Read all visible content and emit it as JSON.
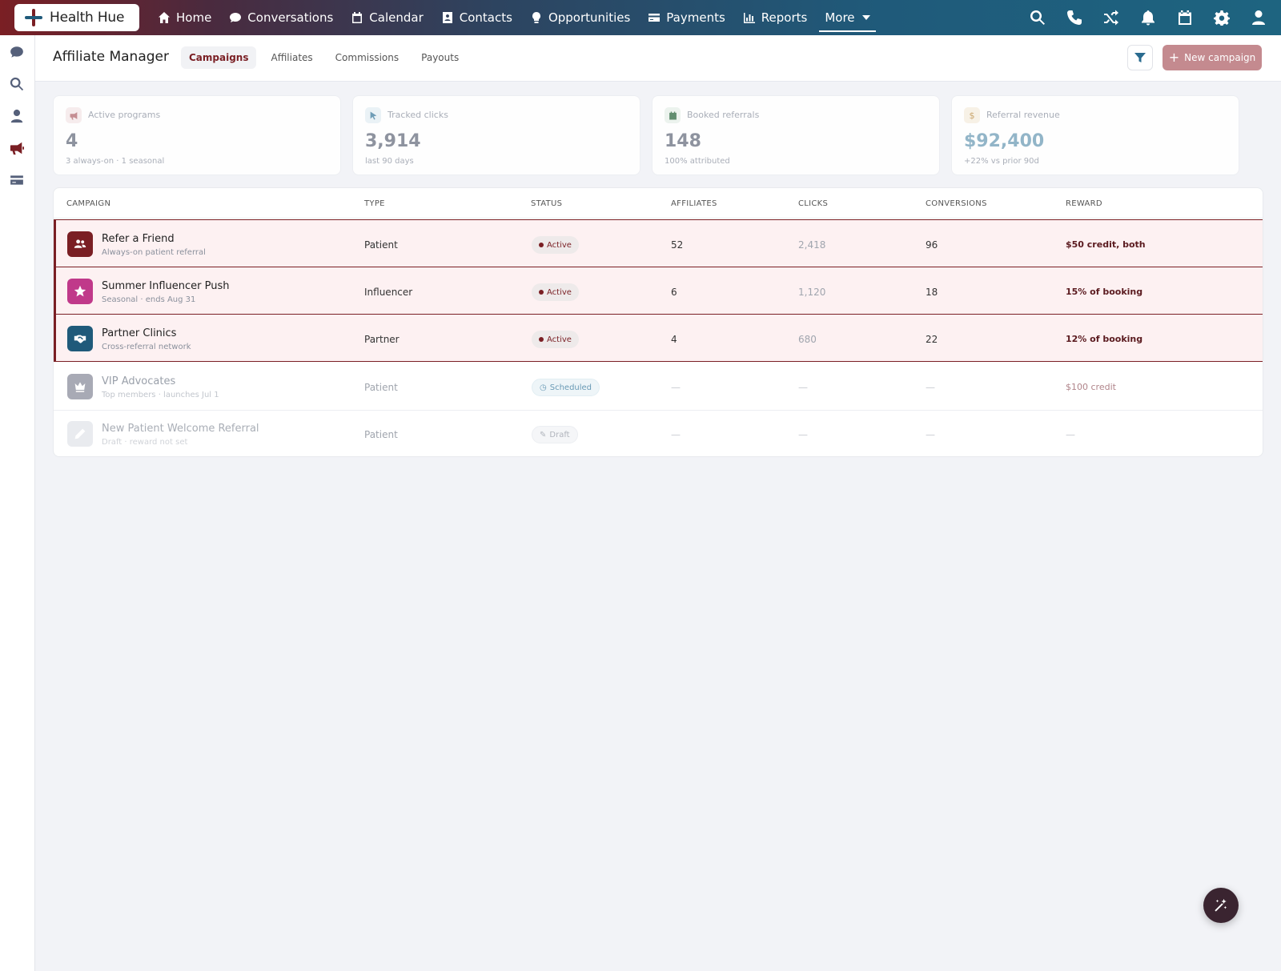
{
  "brand": {
    "name": "Health Hue"
  },
  "nav": {
    "items": [
      {
        "label": "Home",
        "icon": "home-icon"
      },
      {
        "label": "Conversations",
        "icon": "chat-icon"
      },
      {
        "label": "Calendar",
        "icon": "calendar-icon"
      },
      {
        "label": "Contacts",
        "icon": "contact-card-icon"
      },
      {
        "label": "Opportunities",
        "icon": "lightbulb-icon"
      },
      {
        "label": "Payments",
        "icon": "credit-card-icon"
      },
      {
        "label": "Reports",
        "icon": "bar-chart-icon"
      }
    ],
    "more_label": "More"
  },
  "page": {
    "title": "Affiliate Manager",
    "tabs": [
      "Campaigns",
      "Affiliates",
      "Commissions",
      "Payouts"
    ],
    "active_tab": "Campaigns",
    "new_button": "New campaign"
  },
  "stats": [
    {
      "label": "Active programs",
      "value": "4",
      "sub": "3 always-on · 1 seasonal",
      "color": "#c48a8f"
    },
    {
      "label": "Tracked clicks",
      "value": "3,914",
      "sub": "last 90 days",
      "color": "#6a9ab5"
    },
    {
      "label": "Booked referrals",
      "value": "148",
      "sub": "100% attributed",
      "color": "#5c8a6a"
    },
    {
      "label": "Referral revenue",
      "value": "$92,400",
      "sub": "+22% vs prior 90d",
      "color": "#c9a46a"
    }
  ],
  "table": {
    "headers": [
      "CAMPAIGN",
      "TYPE",
      "STATUS",
      "AFFILIATES",
      "CLICKS",
      "CONVERSIONS",
      "REWARD"
    ],
    "rows": [
      {
        "name": "Refer a Friend",
        "sub": "Always-on patient referral",
        "type": "Patient",
        "status": "Active",
        "affiliates": "52",
        "clicks": "2,418",
        "conversions": "96",
        "reward": "$50 credit, both",
        "icon_color": "#7a1f24",
        "icon": "users-icon"
      },
      {
        "name": "Summer Influencer Push",
        "sub": "Seasonal · ends Aug 31",
        "type": "Influencer",
        "status": "Active",
        "affiliates": "6",
        "clicks": "1,120",
        "conversions": "18",
        "reward": "15% of booking",
        "icon_color": "#c0398a",
        "icon": "star-icon"
      },
      {
        "name": "Partner Clinics",
        "sub": "Cross-referral network",
        "type": "Partner",
        "status": "Active",
        "affiliates": "4",
        "clicks": "680",
        "conversions": "22",
        "reward": "12% of booking",
        "icon_color": "#1f5a7a",
        "icon": "handshake-icon"
      },
      {
        "name": "VIP Advocates",
        "sub": "Top members · launches Jul 1",
        "type": "Patient",
        "status": "Scheduled",
        "affiliates": "—",
        "clicks": "—",
        "conversions": "—",
        "reward": "$100 credit",
        "icon_color": "#a8aab5",
        "icon": "crown-icon"
      },
      {
        "name": "New Patient Welcome Referral",
        "sub": "Draft · reward not set",
        "type": "Patient",
        "status": "Draft",
        "affiliates": "—",
        "clicks": "—",
        "conversions": "—",
        "reward": "—",
        "icon_color": "#e6e8ec",
        "icon": "pencil-icon"
      }
    ]
  }
}
